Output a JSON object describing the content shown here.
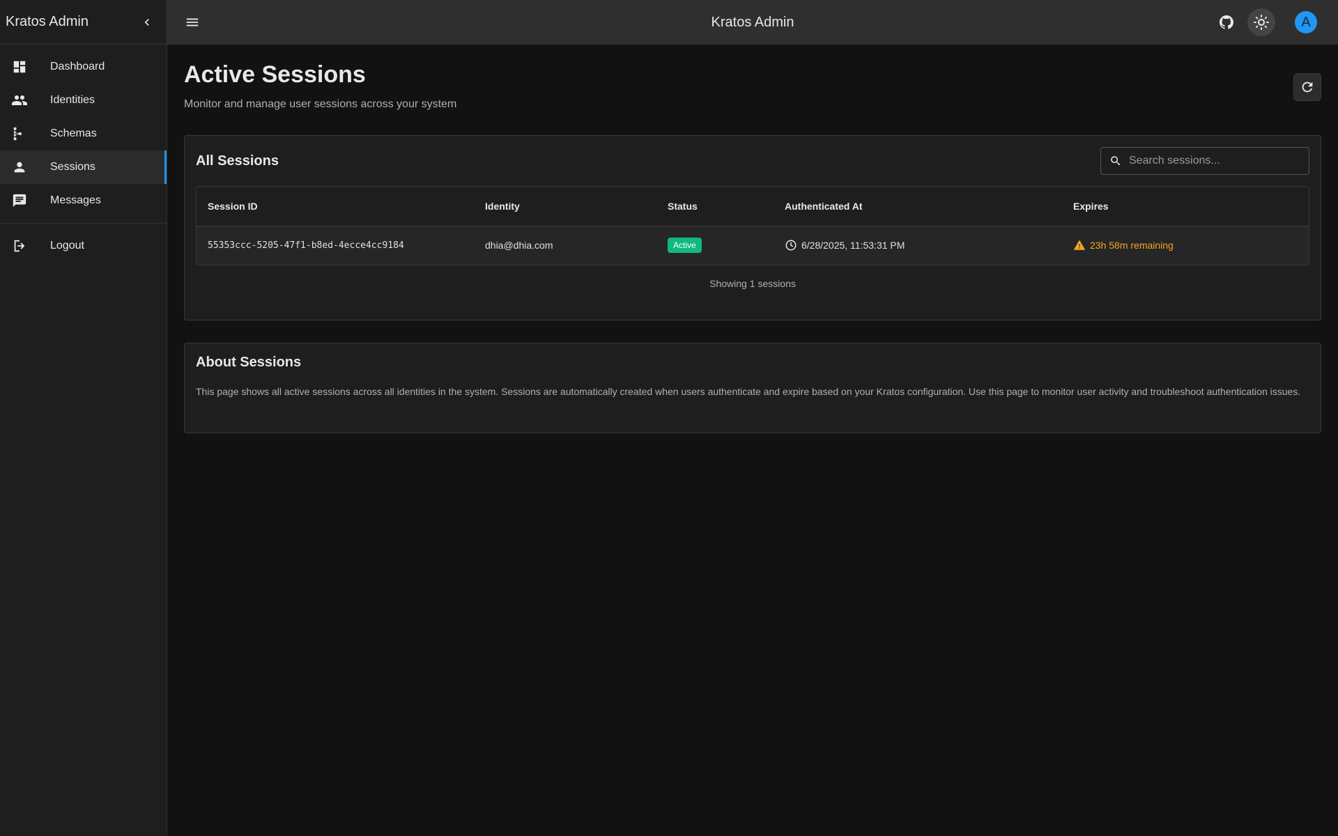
{
  "app": {
    "sidebar_title": "Kratos Admin",
    "topbar_title": "Kratos Admin",
    "avatar_initial": "A"
  },
  "sidebar": {
    "items": [
      {
        "label": "Dashboard",
        "icon": "dashboard-icon"
      },
      {
        "label": "Identities",
        "icon": "people-icon"
      },
      {
        "label": "Schemas",
        "icon": "schema-icon"
      },
      {
        "label": "Sessions",
        "icon": "person-icon",
        "active": true
      },
      {
        "label": "Messages",
        "icon": "message-icon"
      }
    ],
    "logout_label": "Logout"
  },
  "page": {
    "title": "Active Sessions",
    "subtitle": "Monitor and manage user sessions across your system"
  },
  "sessions": {
    "title": "All Sessions",
    "search_placeholder": "Search sessions...",
    "columns": [
      "Session ID",
      "Identity",
      "Status",
      "Authenticated At",
      "Expires"
    ],
    "rows": [
      {
        "id": "55353ccc-5205-47f1-b8ed-4ecce4cc9184",
        "identity": "dhia@dhia.com",
        "status": "Active",
        "authenticated_at": "6/28/2025, 11:53:31 PM",
        "expires": "23h 58m remaining"
      }
    ],
    "footer": "Showing 1 sessions"
  },
  "about": {
    "title": "About Sessions",
    "text": "This page shows all active sessions across all identities in the system. Sessions are automatically created when users authenticate and expire based on your Kratos configuration. Use this page to monitor user activity and troubleshoot authentication issues."
  },
  "colors": {
    "accent": "#2196f3",
    "active_badge": "#10b981",
    "warning": "#f5a623"
  }
}
